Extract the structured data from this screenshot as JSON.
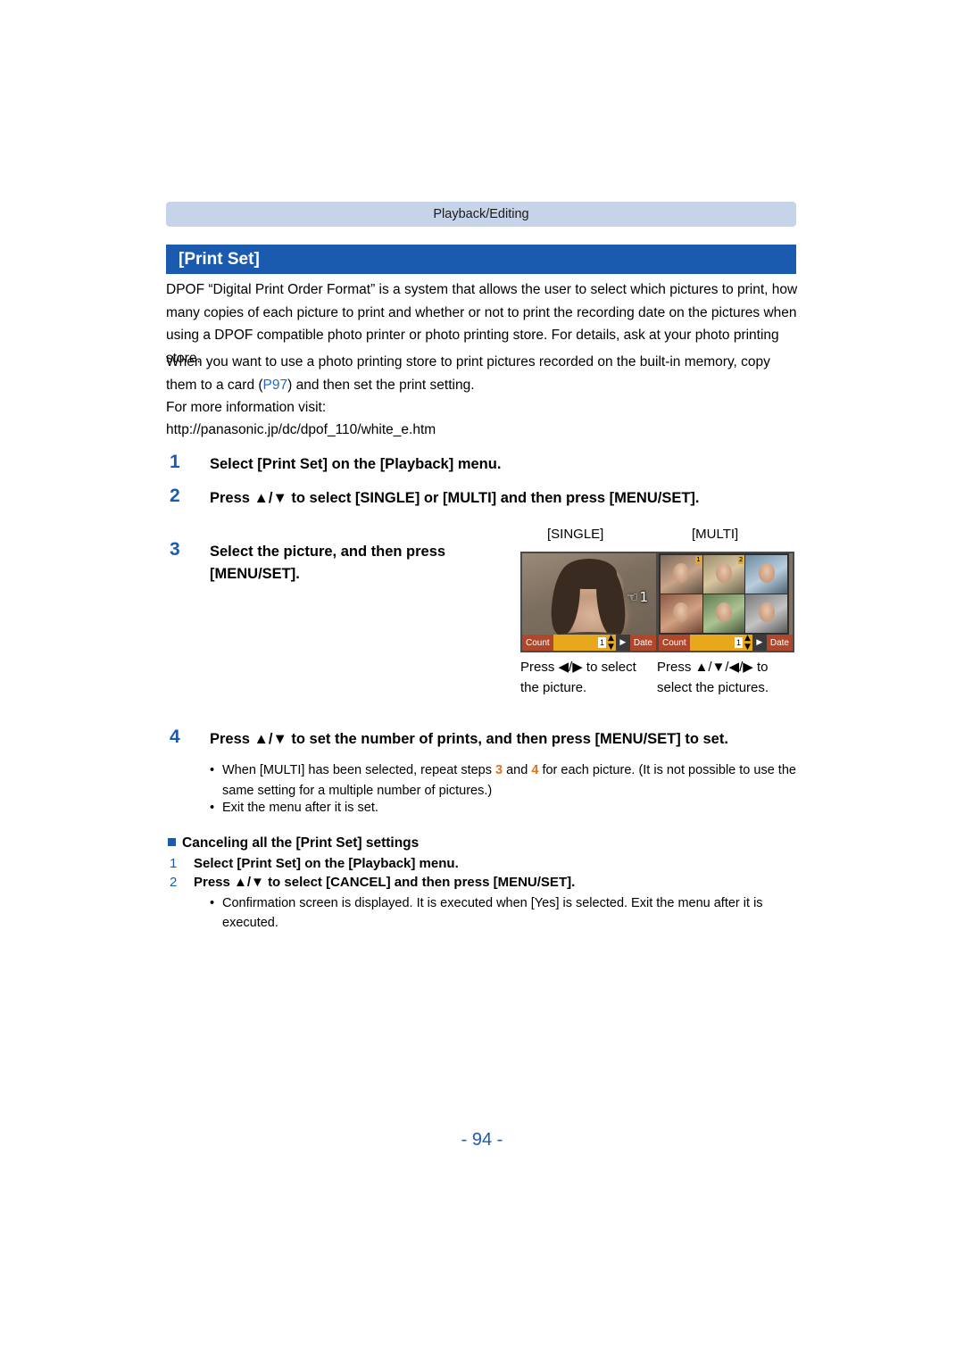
{
  "header": {
    "section": "Playback/Editing",
    "title": "[Print Set]"
  },
  "body": {
    "para1": "DPOF “Digital Print Order Format” is a system that allows the user to select which pictures to print, how many copies of each picture to print and whether or not to print the recording date on the pictures when using a DPOF compatible photo printer or photo printing store. For details, ask at your photo printing store.",
    "para2_a": "When you want to use a photo printing store to print pictures recorded on the built-in memory, copy them to a card (",
    "para2_link": "P97",
    "para2_b": ") and then set the print setting.",
    "para3": "For more information visit:",
    "para4": "http://panasonic.jp/dc/dpof_110/white_e.htm"
  },
  "steps": [
    {
      "num": "1",
      "text": "Select [Print Set] on the [Playback] menu."
    },
    {
      "num": "2",
      "text": "Press ▲/▼ to select [SINGLE] or [MULTI] and then press [MENU/SET]."
    },
    {
      "num": "3",
      "text": "Select the picture, and then press [MENU/SET]."
    },
    {
      "num": "4",
      "text": "Press ▲/▼ to set the number of prints, and then press [MENU/SET] to set."
    }
  ],
  "samples": {
    "single": {
      "label": "[SINGLE]",
      "count_label": "Count",
      "count_value": "1",
      "date_label": "Date",
      "print_badge": "1",
      "note": "Press ◀/▶ to select the picture."
    },
    "multi": {
      "label": "[MULTI]",
      "count_label": "Count",
      "count_value": "1",
      "date_label": "Date",
      "note": "Press ▲/▼/◀/▶ to select the pictures.",
      "thumb_badges": [
        "1",
        "2",
        "",
        "",
        "",
        ""
      ]
    }
  },
  "bullets": [
    {
      "a": "When [MULTI] has been selected, repeat steps ",
      "n1": "3",
      "b": " and ",
      "n2": "4",
      "c": " for each picture. (It is not possible to use the same setting for a multiple number of pictures.)"
    },
    {
      "a": "Exit the menu after it is set.",
      "n1": "",
      "b": "",
      "n2": "",
      "c": ""
    }
  ],
  "cancel": {
    "heading": "Canceling all the [Print Set] settings",
    "step1_num": "1",
    "step1_text": "Select [Print Set] on the [Playback] menu.",
    "step2_num": "2",
    "step2_text": "Press ▲/▼ to select [CANCEL] and then press [MENU/SET].",
    "bullet": "Confirmation screen is displayed. It is executed when [Yes] is selected. Exit the menu after it is executed."
  },
  "footer": {
    "page": "- 94 -"
  },
  "colors": {
    "accent_blue": "#1a5bb0",
    "header_band": "#c6d4ea",
    "link": "#1f6dc0",
    "orange": "#e2711d"
  }
}
